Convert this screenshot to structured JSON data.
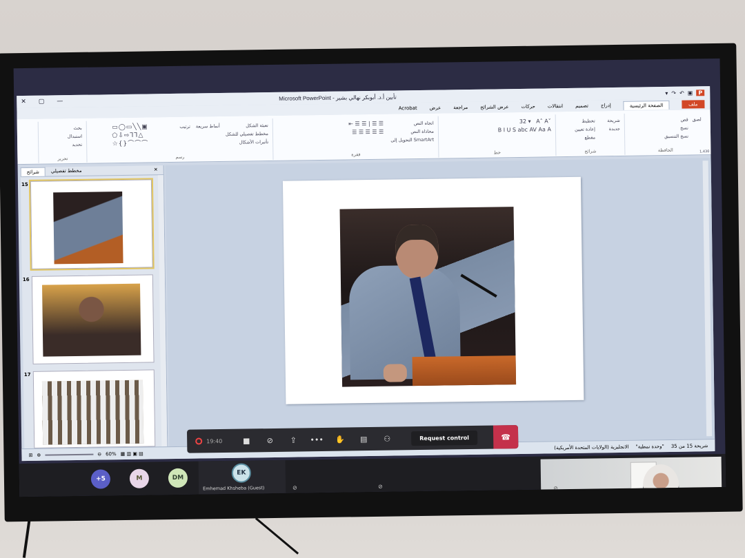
{
  "window": {
    "title": "Microsoft PowerPoint - تأبين أ.د. أبوبكر نهالي بشير",
    "controls": [
      "✕",
      "▢",
      "—"
    ]
  },
  "tabs": {
    "file": "ملف",
    "home": "الصفحة الرئيسية",
    "insert": "إدراج",
    "design": "تصميم",
    "transitions": "انتقالات",
    "animations": "حركات",
    "slideshow": "عرض الشرائح",
    "review": "مراجعة",
    "view": "عرض",
    "acrobat": "Acrobat"
  },
  "ribbon": {
    "clipboard": {
      "label": "الحافظة",
      "paste": "لصق",
      "cut": "قص",
      "copy": "نسخ",
      "format": "نسخ التنسيق"
    },
    "slides": {
      "label": "شرائح",
      "new_slide": "شريحة جديدة",
      "layout": "تخطيط",
      "reset": "إعادة تعيين",
      "section": "مقطع"
    },
    "font": {
      "label": "خط",
      "size": "32"
    },
    "paragraph": {
      "label": "فقرة",
      "text_direction": "اتجاه النص",
      "align_text": "محاذاة النص",
      "smartart": "التحويل إلى SmartArt"
    },
    "drawing": {
      "label": "رسم",
      "arrange": "ترتيب",
      "quick_styles": "أنماط سريعة",
      "shape_fill": "تعبئة الشكل",
      "shape_outline": "مخطط تفصيلي للشكل",
      "shape_effects": "تأثيرات الأشكال"
    },
    "editing": {
      "label": "تحرير",
      "find": "بحث",
      "replace": "استبدال",
      "select": "تحديد"
    }
  },
  "thumbnails": {
    "tab_slides": "شرائح",
    "tab_outline": "مخطط تفصيلي",
    "close": "✕",
    "items": [
      {
        "num": "15"
      },
      {
        "num": "16"
      },
      {
        "num": "17"
      }
    ]
  },
  "statusbar": {
    "zoom": "60%",
    "slide_info": "شريحة 15 من 35",
    "theme": "\"وحدة نمطية\"",
    "language": "الانجليزية (الولايات المتحدة الأمريكية)"
  },
  "ruler_readout": "1,430",
  "teams": {
    "time": "19:40",
    "request_control": "Request control",
    "participants": [
      {
        "initials": "+5",
        "color": "#5b5fc7"
      },
      {
        "initials": "M",
        "color": "#e8d6e8"
      },
      {
        "initials": "DM",
        "color": "#cfe6b8"
      },
      {
        "initials": "EK",
        "color": "#cbe3ea",
        "name": "Emhemad Khsheba (Guest)"
      }
    ]
  }
}
